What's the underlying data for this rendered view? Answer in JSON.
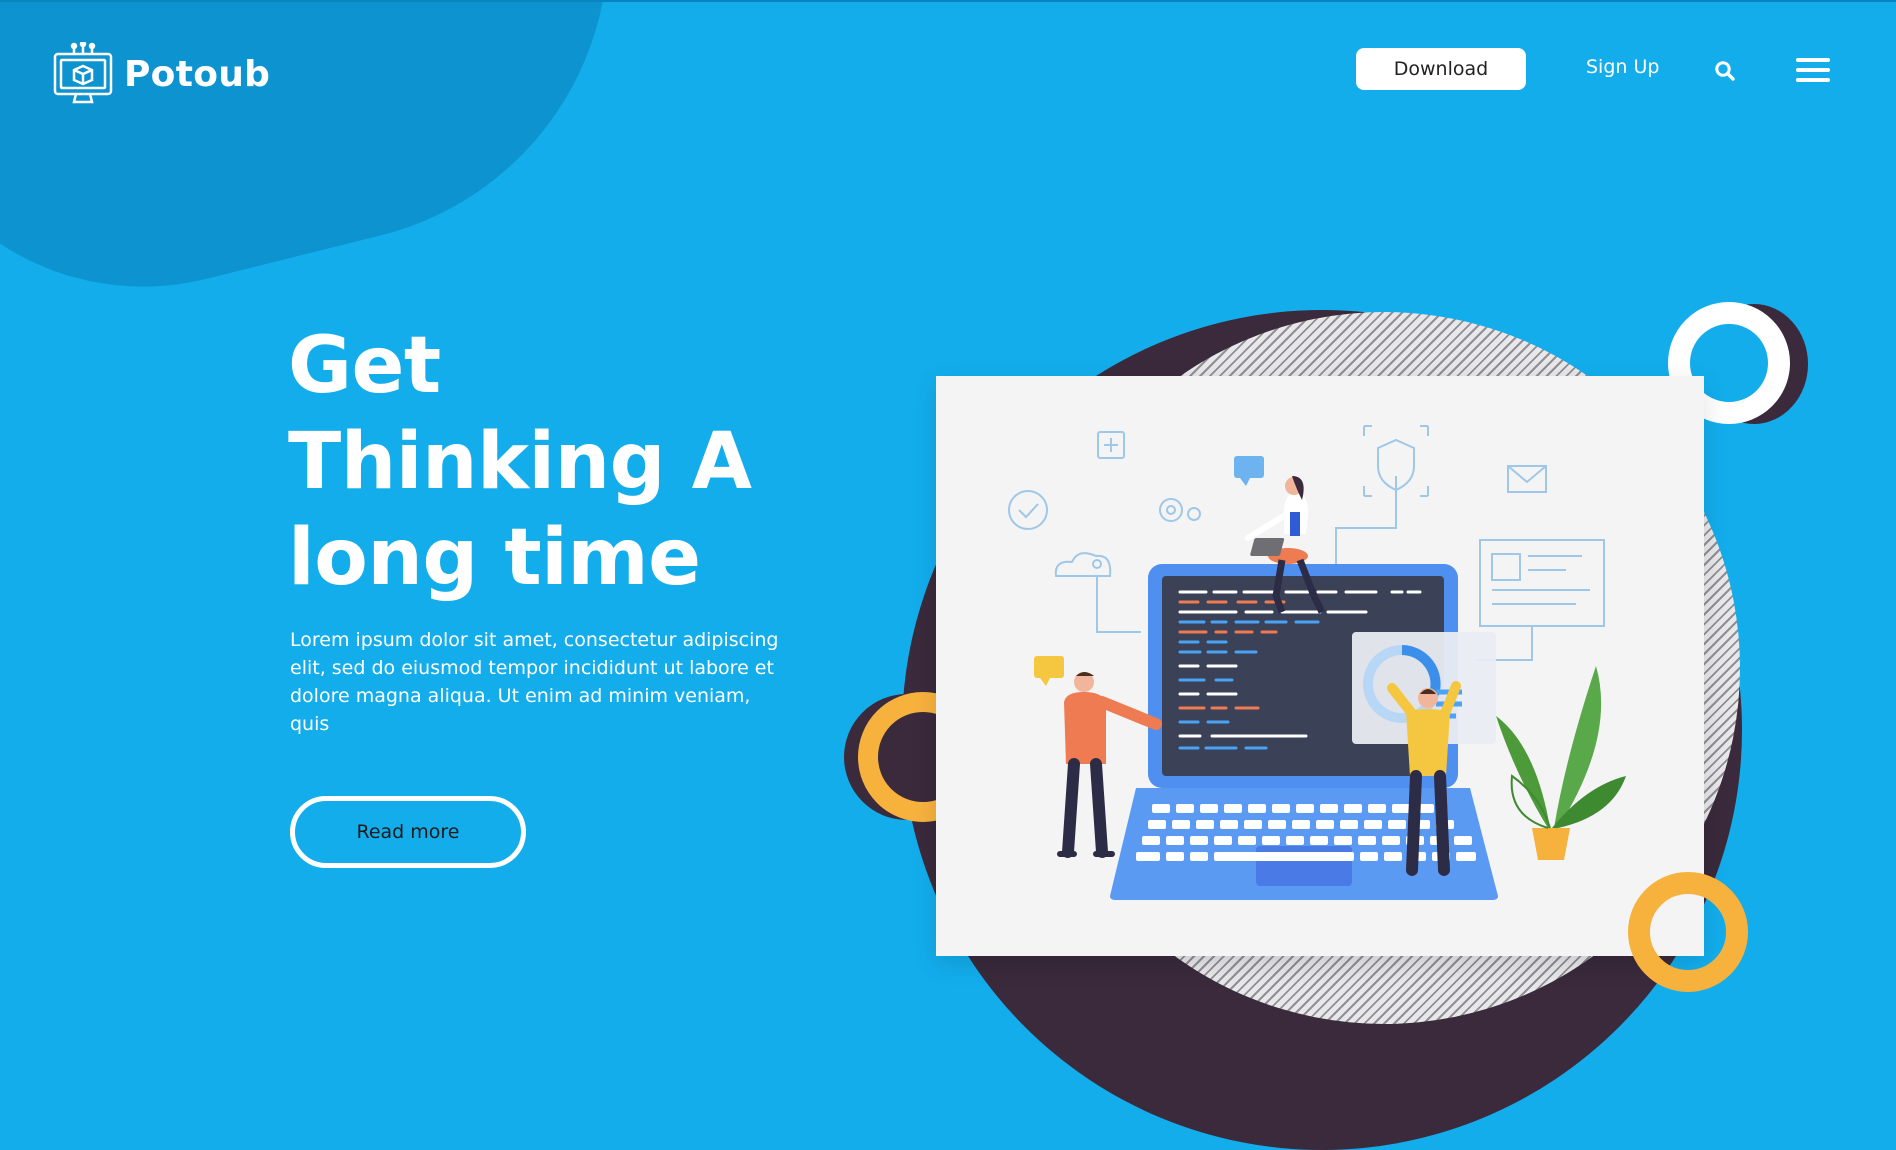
{
  "brand": {
    "name": "Potoub",
    "logo_icon": "monitor-cube-icon"
  },
  "nav": {
    "download_label": "Download",
    "signup_label": "Sign Up",
    "search_icon": "search-icon",
    "menu_icon": "hamburger-menu-icon"
  },
  "hero": {
    "title_lines": [
      "Get",
      "Thinking A",
      "long time"
    ],
    "description": "Lorem ipsum dolor sit amet, consectetur adipiscing elit, sed do eiusmod tempor incididunt ut labore et dolore magna aliqua. Ut enim ad minim veniam, quis",
    "cta_label": "Read more"
  },
  "illustration": {
    "subject": "people-working-on-laptop-code-illustration",
    "icons": [
      "plus-icon",
      "check-circle-icon",
      "gear-icon",
      "cloud-icon",
      "shield-icon",
      "mail-icon",
      "chat-bubble-icon",
      "plant-icon",
      "chart-donut-icon"
    ]
  },
  "colors": {
    "background": "#13adec",
    "blob": "#0d93d0",
    "dark_accent": "#3a2a3c",
    "orange_accent": "#f7b23e",
    "card": "#f4f4f5"
  }
}
